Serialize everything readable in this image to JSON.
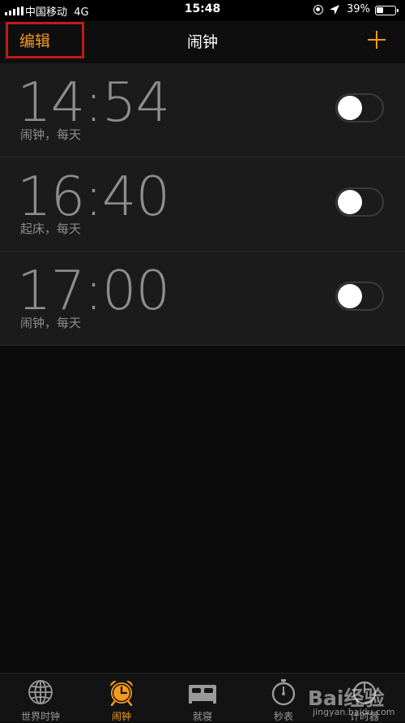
{
  "status_bar": {
    "carrier": "中国移动",
    "network": "4G",
    "time": "15:48",
    "battery_percent": "39%",
    "battery_level": 0.39
  },
  "nav": {
    "edit_label": "编辑",
    "title": "闹钟",
    "add_icon": "plus-icon",
    "accent_color": "#f39a1e"
  },
  "alarms": [
    {
      "time": "14:54",
      "label": "闹钟，每天",
      "enabled": false
    },
    {
      "time": "16:40",
      "label": "起床，每天",
      "enabled": false
    },
    {
      "time": "17:00",
      "label": "闹钟，每天",
      "enabled": false
    }
  ],
  "tabs": [
    {
      "label": "世界时钟",
      "icon": "globe-icon",
      "active": false
    },
    {
      "label": "闹钟",
      "icon": "alarm-clock-icon",
      "active": true
    },
    {
      "label": "就寝",
      "icon": "bed-icon",
      "active": false
    },
    {
      "label": "秒表",
      "icon": "stopwatch-icon",
      "active": false
    },
    {
      "label": "计时器",
      "icon": "timer-icon",
      "active": false
    }
  ],
  "watermark": {
    "brand": "Bai经验",
    "url": "jingyan.baidu.com"
  }
}
